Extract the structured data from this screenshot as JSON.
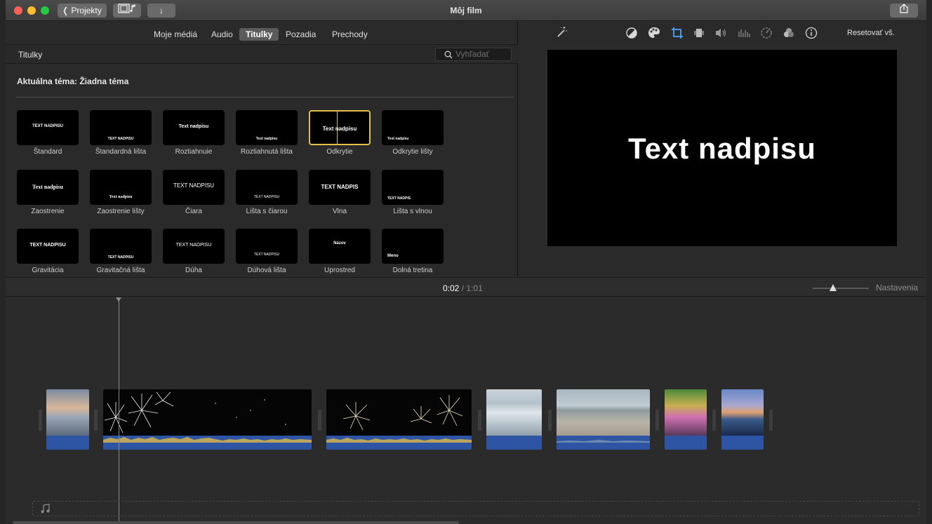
{
  "window": {
    "title": "Môj film",
    "back_label": "Projekty"
  },
  "browser": {
    "tabs": [
      {
        "label": "Moje médiá"
      },
      {
        "label": "Audio"
      },
      {
        "label": "Titulky"
      },
      {
        "label": "Pozadia"
      },
      {
        "label": "Prechody"
      }
    ],
    "header_title": "Titulky",
    "search_placeholder": "Vyhľadať",
    "theme_label": "Aktuálna téma: Žiadna téma",
    "titles": [
      {
        "label": "Štandard",
        "preview": "TEXT NADPISU"
      },
      {
        "label": "Štandardná lišta",
        "preview": "TEXT NADPISU"
      },
      {
        "label": "Roztiahnuie",
        "preview": "Text nadpisu"
      },
      {
        "label": "Roztiahnutá lišta",
        "preview": "Text nadpisu"
      },
      {
        "label": "Odkrytie",
        "preview": "Text nadpisu"
      },
      {
        "label": "Odkrytie lišty",
        "preview": "Text nadpisu"
      },
      {
        "label": "Zaostrenie",
        "preview": "Text nadpisu"
      },
      {
        "label": "Zaostrenie lišty",
        "preview": "Text nadpisu"
      },
      {
        "label": "Čiara",
        "preview": "TEXT NADPISU"
      },
      {
        "label": "Lišta s čiarou",
        "preview": "TEXT NADPISU"
      },
      {
        "label": "Vlna",
        "preview": "TEXT NADPIS"
      },
      {
        "label": "Lišta s vlnou",
        "preview": "TEXT NADPIS"
      },
      {
        "label": "Gravitácia",
        "preview": "TEXT NADPISU"
      },
      {
        "label": "Gravitačná lišta",
        "preview": "TEXT NADPISU"
      },
      {
        "label": "Dúha",
        "preview": "TEXT NADPISU"
      },
      {
        "label": "Dúhová lišta",
        "preview": "TEXT NADPISU"
      },
      {
        "label": "Uprostred",
        "preview": "Názov"
      },
      {
        "label": "Dolná tretina",
        "preview": "Meno"
      }
    ]
  },
  "viewer": {
    "reset_label": "Resetovať vš.",
    "title_text": "Text nadpisu"
  },
  "timebar": {
    "current": "0:02",
    "separator": "/",
    "duration": "1:01",
    "settings_label": "Nastavenia"
  },
  "colors": {
    "accent": "#e3be4a",
    "audio": "#2e55a3",
    "waveform": "#e0b84a"
  }
}
